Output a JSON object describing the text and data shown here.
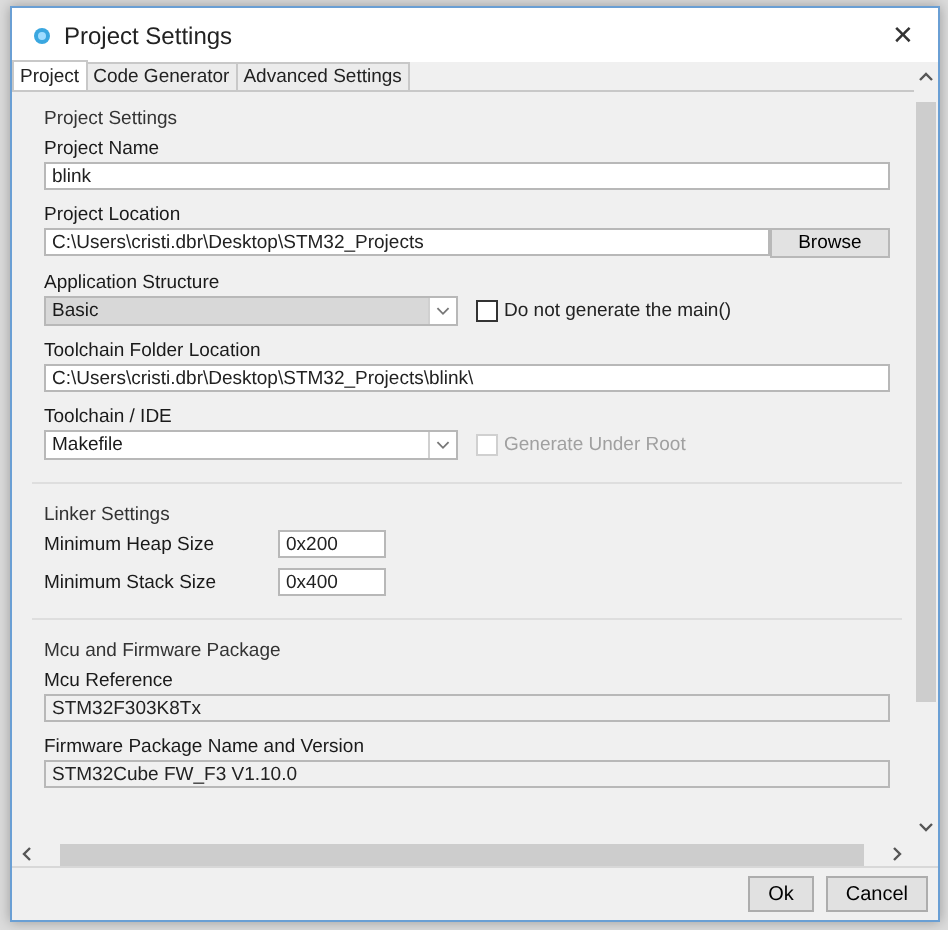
{
  "window": {
    "title": "Project Settings",
    "close": "✕"
  },
  "tabs": [
    {
      "label": "Project",
      "selected": true
    },
    {
      "label": "Code Generator",
      "selected": false
    },
    {
      "label": "Advanced Settings",
      "selected": false
    }
  ],
  "sections": [
    {
      "title": "Project Settings",
      "fields": [
        {
          "kind": "text",
          "label": "Project Name",
          "value": "blink"
        },
        {
          "kind": "browse",
          "label": "Project Location",
          "value": "C:\\Users\\cristi.dbr\\Desktop\\STM32_Projects",
          "button": "Browse"
        },
        {
          "kind": "select",
          "label": "Application Structure",
          "value": "Basic",
          "disabled": true,
          "checkbox": {
            "label": "Do not generate the main()",
            "checked": false,
            "disabled": false
          }
        },
        {
          "kind": "text",
          "label": "Toolchain Folder Location",
          "value": "C:\\Users\\cristi.dbr\\Desktop\\STM32_Projects\\blink\\"
        },
        {
          "kind": "select",
          "label": "Toolchain / IDE",
          "value": "Makefile",
          "disabled": false,
          "checkbox": {
            "label": "Generate Under Root",
            "checked": false,
            "disabled": true
          }
        }
      ]
    },
    {
      "title": "Linker Settings",
      "fields": [
        {
          "kind": "short",
          "label": "Minimum Heap Size",
          "value": "0x200"
        },
        {
          "kind": "short",
          "label": "Minimum Stack Size",
          "value": "0x400"
        }
      ]
    },
    {
      "title": "Mcu and Firmware Package",
      "fields": [
        {
          "kind": "readonly",
          "label": "Mcu Reference",
          "value": "STM32F303K8Tx"
        },
        {
          "kind": "readonly",
          "label": "Firmware Package Name and Version",
          "value": "STM32Cube FW_F3 V1.10.0"
        }
      ]
    }
  ],
  "buttons": [
    "Ok",
    "Cancel"
  ]
}
